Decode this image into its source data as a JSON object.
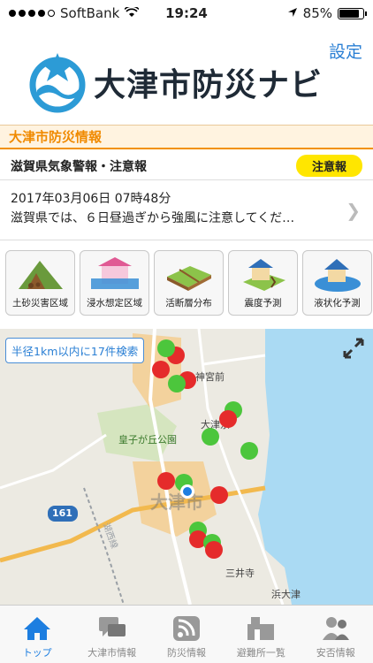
{
  "status_bar": {
    "carrier": "SoftBank",
    "time": "19:24",
    "battery": "85%",
    "battery_level": 0.85
  },
  "header": {
    "settings_label": "設定",
    "app_title": "大津市防災ナビ"
  },
  "section": {
    "title": "大津市防災情報"
  },
  "alert": {
    "title": "滋賀県気象警報・注意報",
    "badge": "注意報",
    "date": "2017年03月06日 07時48分",
    "message": "滋賀県では、６日昼過ぎから強風に注意してくだ…"
  },
  "tiles": [
    {
      "label": "土砂災害区域",
      "icon": "landslide-icon"
    },
    {
      "label": "浸水想定区域",
      "icon": "flood-icon"
    },
    {
      "label": "活断層分布",
      "icon": "fault-icon"
    },
    {
      "label": "震度予測",
      "icon": "earthquake-icon"
    },
    {
      "label": "液状化予測",
      "icon": "liquefaction-icon"
    }
  ],
  "map": {
    "search_chip": "半径1km以内に17件検索",
    "places": [
      "神宮前",
      "大津京",
      "皇子が丘公園",
      "大津市",
      "三井寺",
      "浜大津"
    ],
    "route_number": "161",
    "road_label": "湖西線"
  },
  "tabs": [
    {
      "label": "トップ",
      "icon": "home-icon",
      "active": true
    },
    {
      "label": "大津市情報",
      "icon": "chat-icon",
      "active": false
    },
    {
      "label": "防災情報",
      "icon": "rss-icon",
      "active": false
    },
    {
      "label": "避難所一覧",
      "icon": "shelter-icon",
      "active": false
    },
    {
      "label": "安否情報",
      "icon": "people-icon",
      "active": false
    }
  ],
  "colors": {
    "accent": "#f08a00",
    "link": "#2a7fd4",
    "badge": "#ffe600",
    "tab_active": "#1d7ee0"
  }
}
